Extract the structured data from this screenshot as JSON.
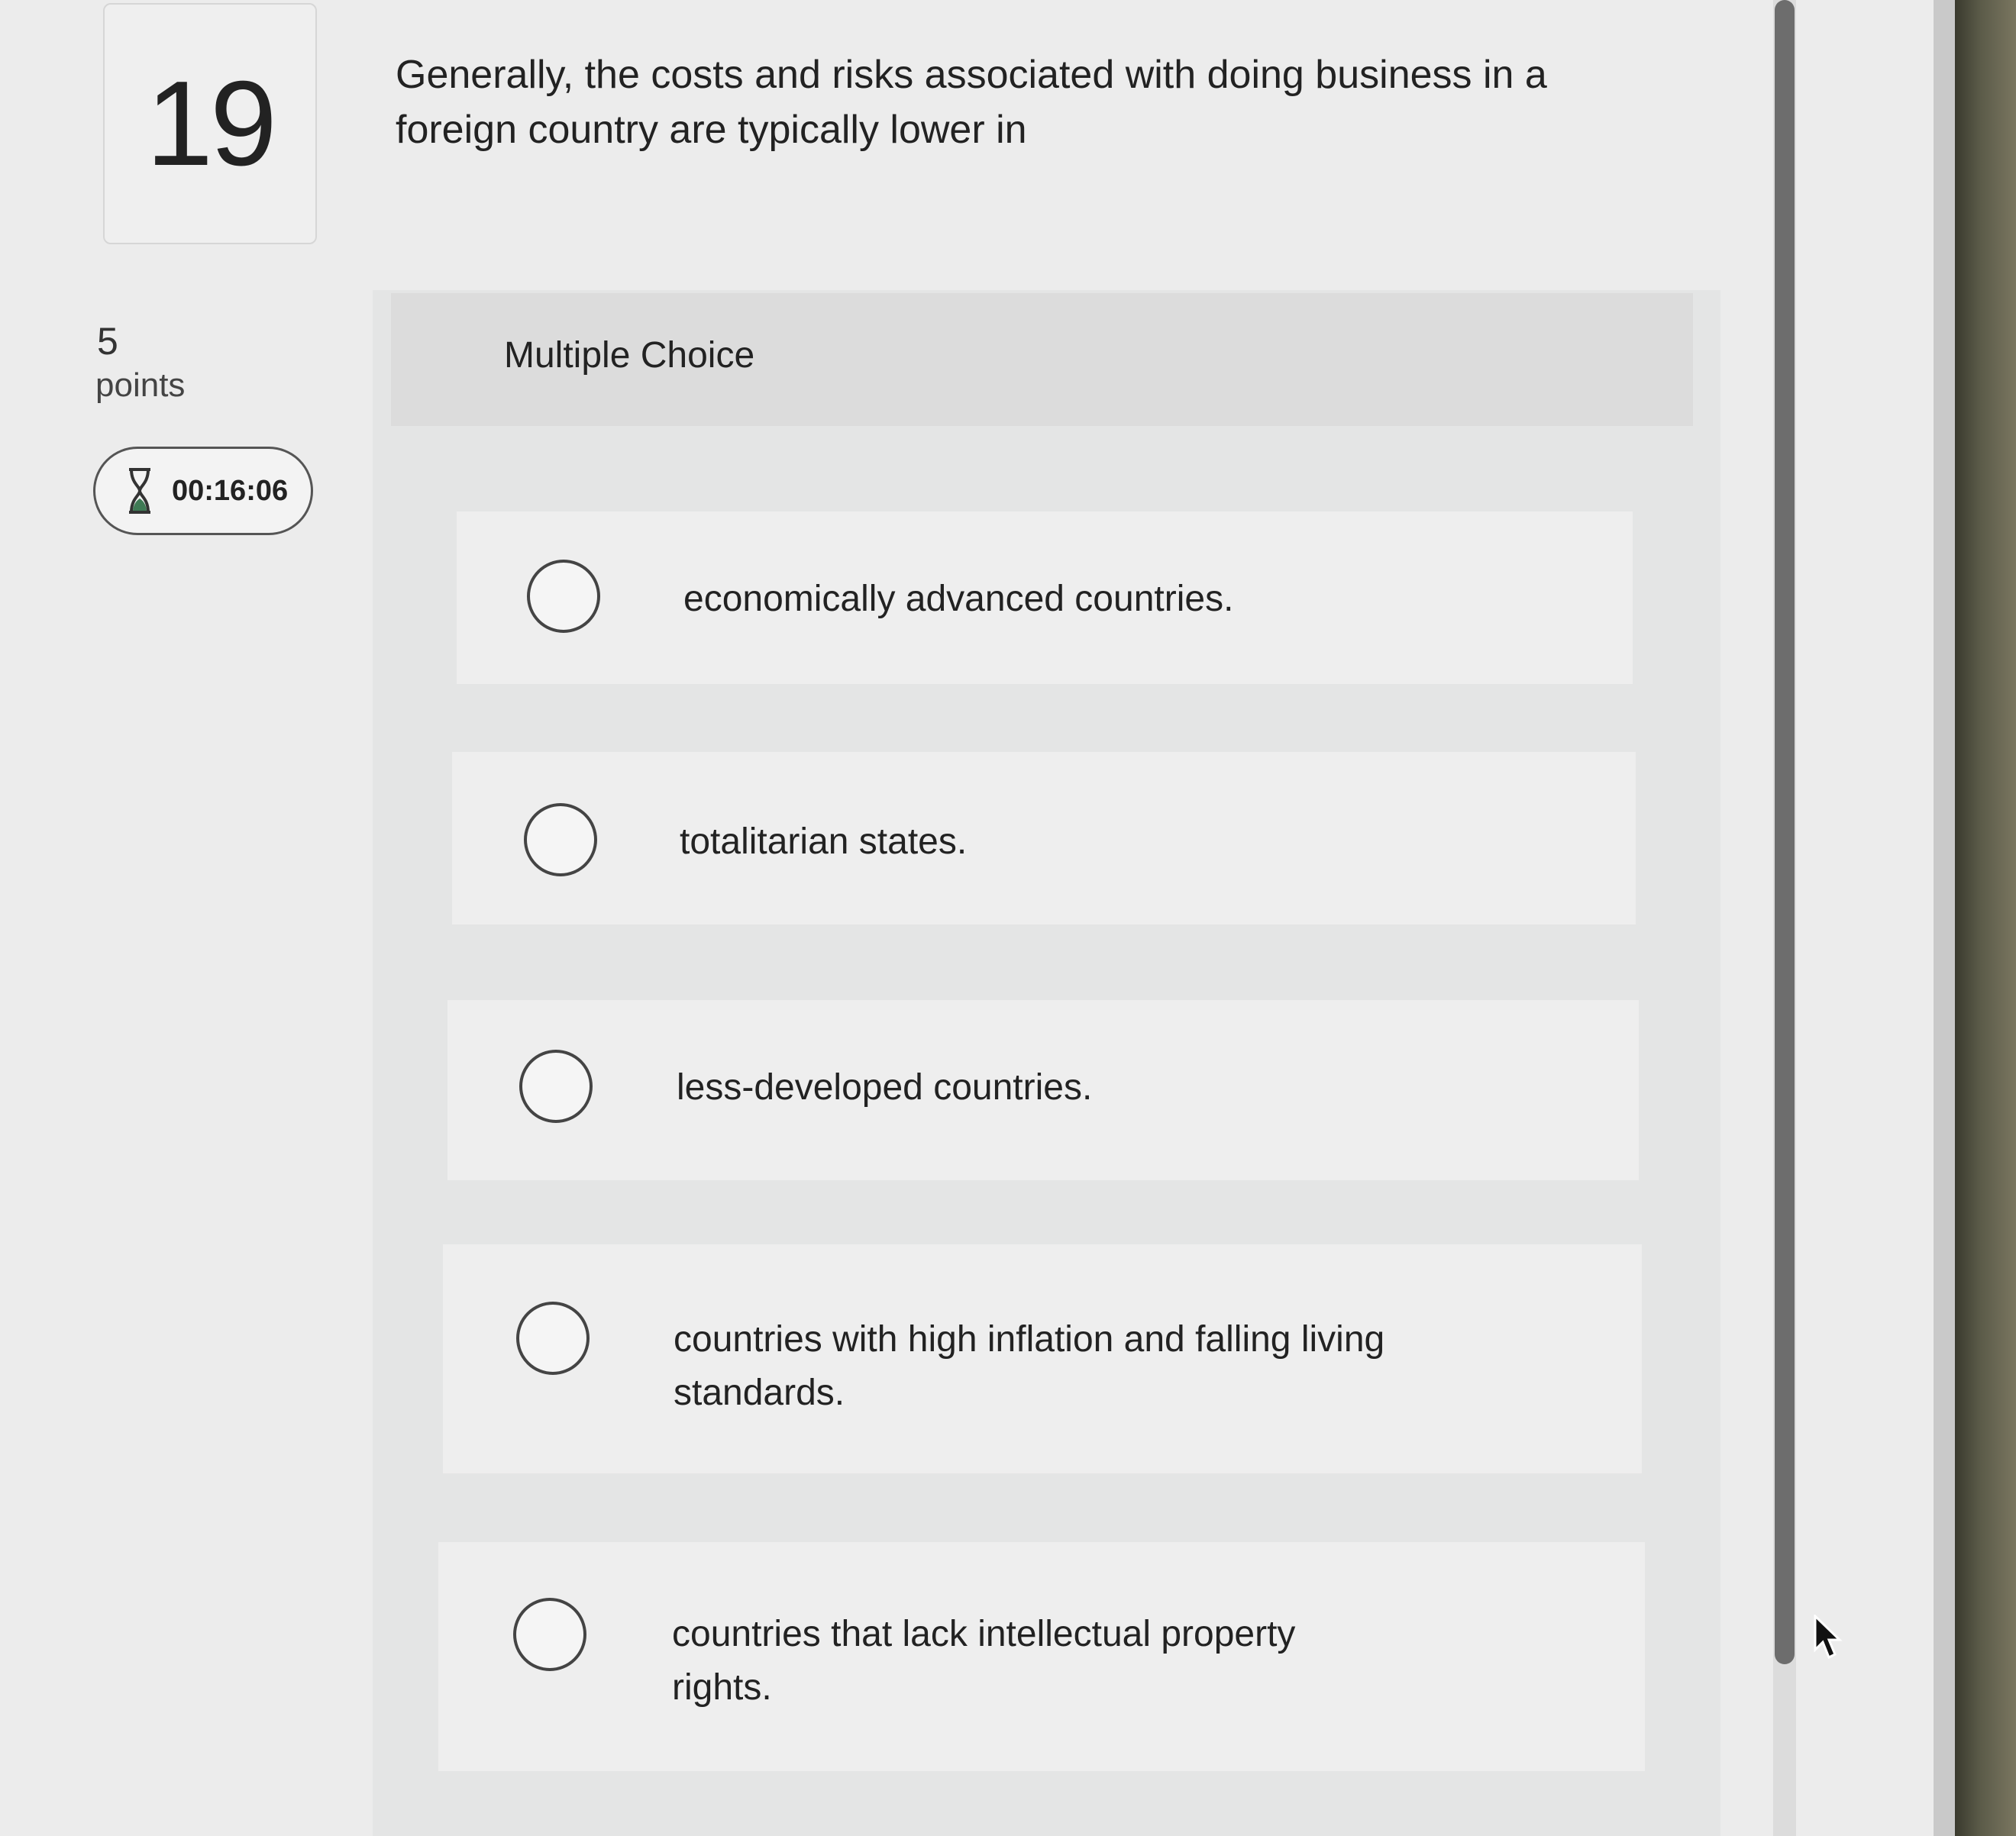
{
  "question": {
    "number": "19",
    "points_value": "5",
    "points_label": "points",
    "timer": "00:16:06",
    "text": "Generally, the costs and risks associated with doing business in a foreign country are typically lower in"
  },
  "answer_panel": {
    "title": "Multiple Choice",
    "choices": [
      {
        "label": "economically advanced countries."
      },
      {
        "label": "totalitarian states."
      },
      {
        "label": "less-developed countries."
      },
      {
        "label": "countries with high inflation and falling living standards."
      },
      {
        "label": "countries that lack intellectual property rights."
      }
    ]
  },
  "icons": {
    "timer": "hourglass-icon",
    "cursor": "mouse-pointer-icon"
  }
}
